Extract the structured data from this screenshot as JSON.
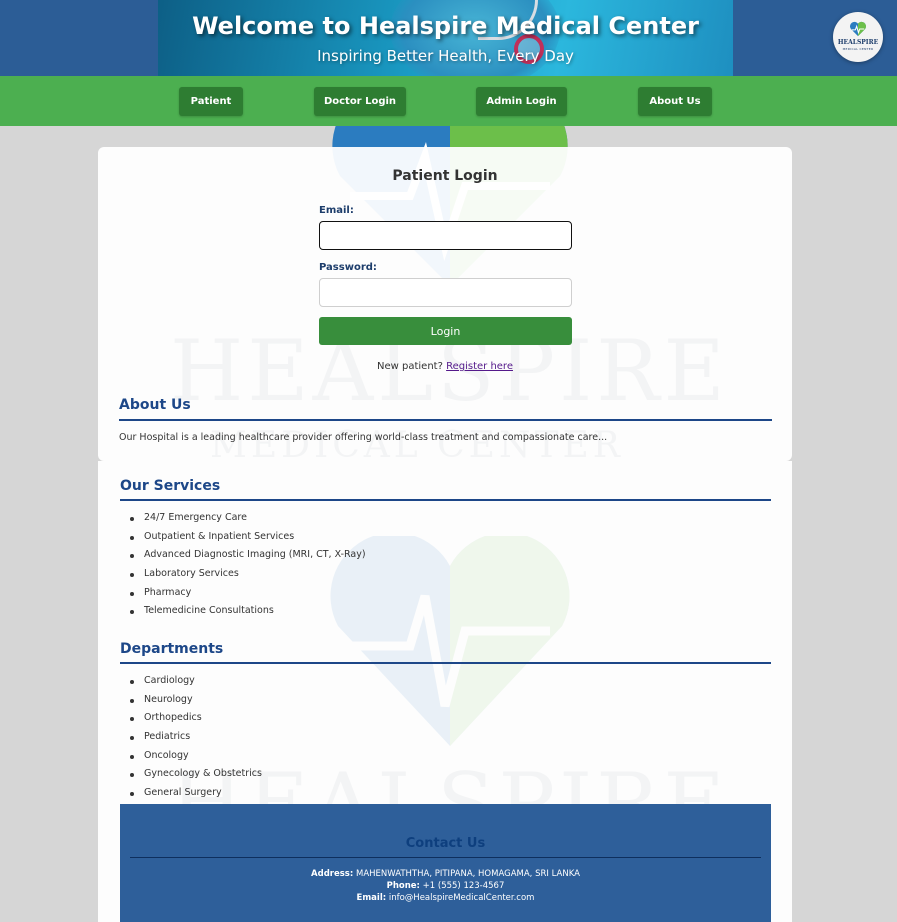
{
  "header": {
    "title": "Welcome to Healspire Medical Center",
    "subtitle": "Inspiring Better Health, Every Day",
    "logo_text": "HEALSPIRE",
    "logo_sub": "MEDICAL CENTER"
  },
  "nav": {
    "items": [
      {
        "label": "Patient"
      },
      {
        "label": "Doctor Login"
      },
      {
        "label": "Admin Login"
      },
      {
        "label": "About Us"
      }
    ]
  },
  "login": {
    "title": "Patient Login",
    "email_label": "Email:",
    "email_value": "",
    "password_label": "Password:",
    "password_value": "",
    "button_label": "Login",
    "register_prompt": "New patient?",
    "register_link": "Register here"
  },
  "watermark": {
    "main": "HEALSPIRE",
    "sub": "MEDICAL CENTER"
  },
  "about": {
    "title": "About Us",
    "text": "Our Hospital is a leading healthcare provider offering world-class treatment and compassionate care..."
  },
  "services": {
    "title": "Our Services",
    "items": [
      "24/7 Emergency Care",
      "Outpatient & Inpatient Services",
      "Advanced Diagnostic Imaging (MRI, CT, X-Ray)",
      "Laboratory Services",
      "Pharmacy",
      "Telemedicine Consultations"
    ]
  },
  "departments": {
    "title": "Departments",
    "items": [
      "Cardiology",
      "Neurology",
      "Orthopedics",
      "Pediatrics",
      "Oncology",
      "Gynecology & Obstetrics",
      "General Surgery"
    ]
  },
  "contact": {
    "title": "Contact Us",
    "address_label": "Address:",
    "address": "MAHENWATHTHA, PITIPANA, HOMAGAMA, SRI LANKA",
    "phone_label": "Phone:",
    "phone": "+1 (555) 123-4567",
    "email_label": "Email:",
    "email": "info@HealspireMedicalCenter.com"
  },
  "colors": {
    "header_bg": "#2c5d96",
    "nav_bg": "#4caf50",
    "nav_button": "#2e7d32",
    "login_button": "#388e3c",
    "section_heading": "#1d4788",
    "contact_bg": "#2e5f9a"
  }
}
